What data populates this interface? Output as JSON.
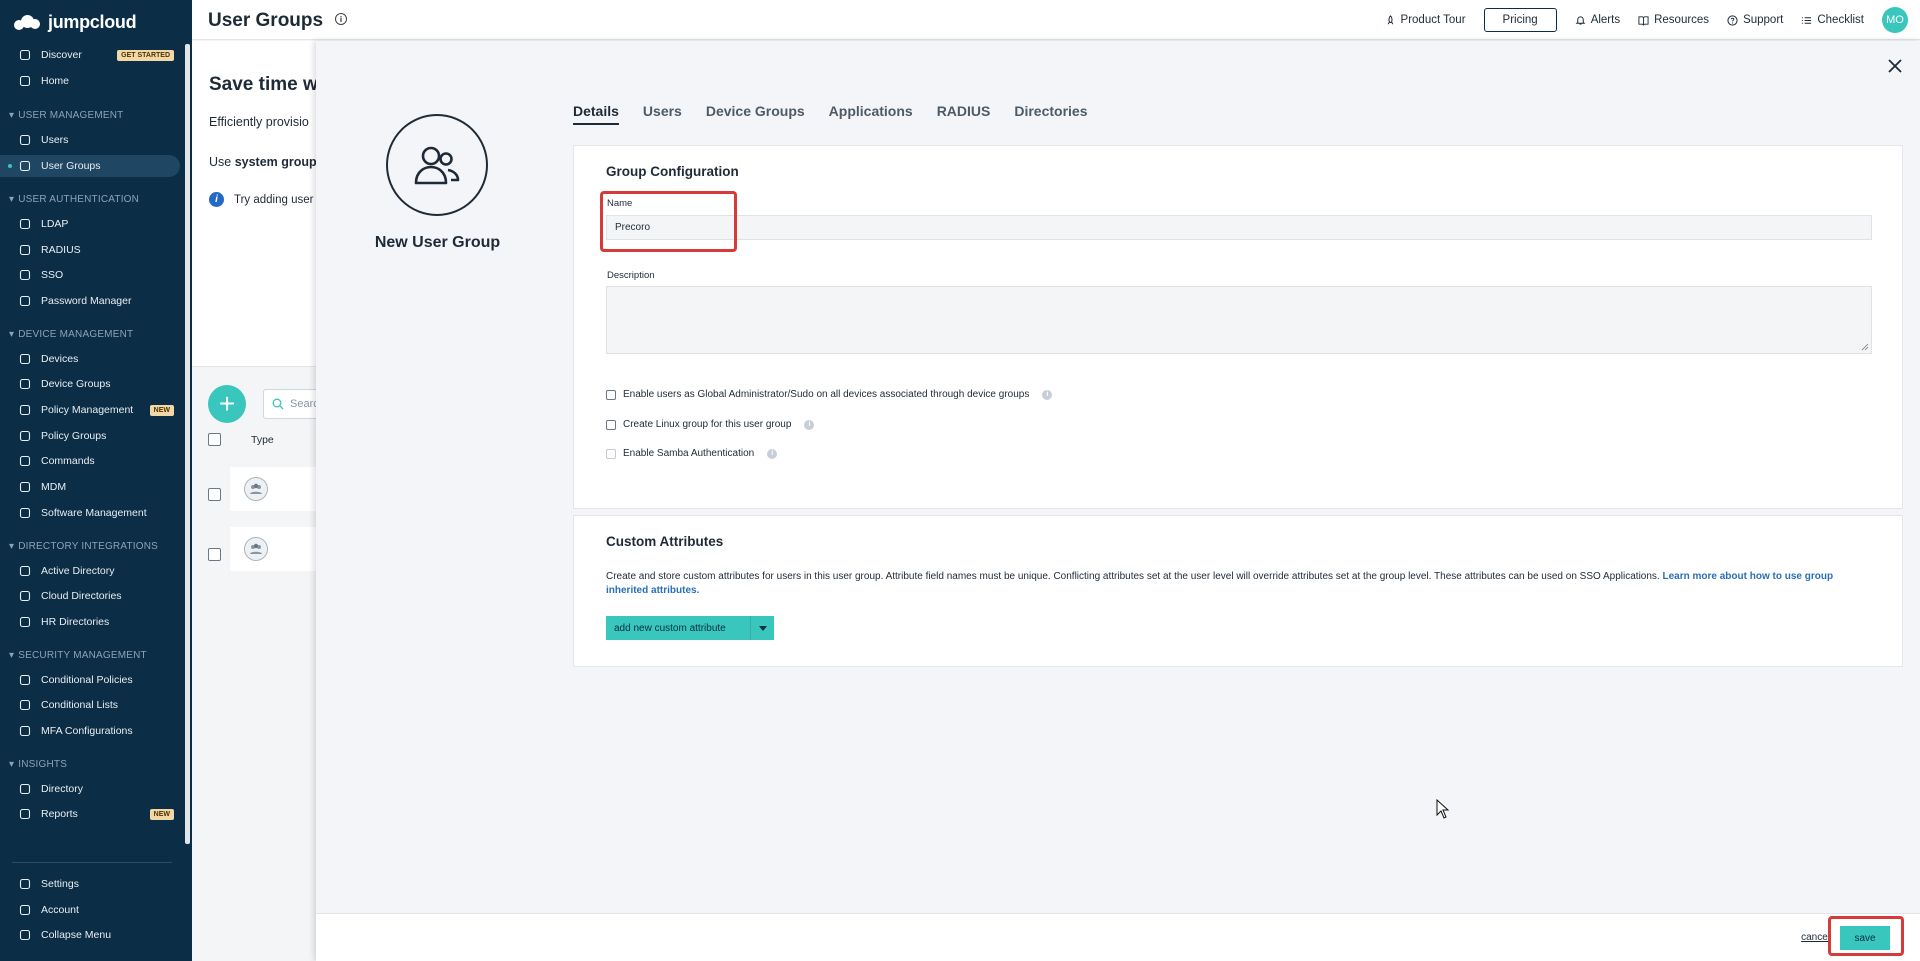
{
  "app": {
    "logo_text": "jumpcloud",
    "page_title": "User Groups"
  },
  "sidebar": {
    "items_top": [
      {
        "label": "Discover",
        "badge": "GET STARTED"
      },
      {
        "label": "Home"
      }
    ],
    "sections": [
      {
        "title": "USER MANAGEMENT",
        "items": [
          {
            "label": "Users"
          },
          {
            "label": "User Groups",
            "active": true
          }
        ]
      },
      {
        "title": "USER AUTHENTICATION",
        "items": [
          {
            "label": "LDAP"
          },
          {
            "label": "RADIUS"
          },
          {
            "label": "SSO"
          },
          {
            "label": "Password Manager"
          }
        ]
      },
      {
        "title": "DEVICE MANAGEMENT",
        "items": [
          {
            "label": "Devices"
          },
          {
            "label": "Device Groups"
          },
          {
            "label": "Policy Management",
            "badge": "NEW"
          },
          {
            "label": "Policy Groups"
          },
          {
            "label": "Commands"
          },
          {
            "label": "MDM"
          },
          {
            "label": "Software Management"
          }
        ]
      },
      {
        "title": "DIRECTORY INTEGRATIONS",
        "items": [
          {
            "label": "Active Directory"
          },
          {
            "label": "Cloud Directories"
          },
          {
            "label": "HR Directories"
          }
        ]
      },
      {
        "title": "SECURITY MANAGEMENT",
        "items": [
          {
            "label": "Conditional Policies"
          },
          {
            "label": "Conditional Lists"
          },
          {
            "label": "MFA Configurations"
          }
        ]
      },
      {
        "title": "INSIGHTS",
        "items": [
          {
            "label": "Directory"
          },
          {
            "label": "Reports",
            "badge": "NEW"
          }
        ]
      }
    ],
    "bottom": [
      {
        "label": "Settings"
      },
      {
        "label": "Account"
      },
      {
        "label": "Collapse Menu"
      }
    ]
  },
  "topnav": {
    "product_tour": "Product Tour",
    "pricing": "Pricing",
    "alerts": "Alerts",
    "resources": "Resources",
    "support": "Support",
    "checklist": "Checklist",
    "avatar_initials": "MO"
  },
  "background": {
    "title": "Save time w",
    "text1": "Efficiently provisio",
    "text2_prefix": "Use ",
    "text2_bold": "system group",
    "info_text": "Try adding user",
    "search_placeholder": "Searc",
    "col_type": "Type"
  },
  "panel": {
    "group_name": "New User Group",
    "tabs": [
      "Details",
      "Users",
      "Device Groups",
      "Applications",
      "RADIUS",
      "Directories"
    ],
    "config": {
      "title": "Group Configuration",
      "name_label": "Name",
      "name_value": "Precoro",
      "description_label": "Description",
      "checks": [
        {
          "label": "Enable users as Global Administrator/Sudo on all devices associated through device groups",
          "help": true
        },
        {
          "label": "Create Linux group for this user group",
          "help": true
        },
        {
          "label": "Enable Samba Authentication",
          "help": true,
          "disabled": true
        }
      ]
    },
    "custom": {
      "title": "Custom Attributes",
      "desc": "Create and store custom attributes for users in this user group. Attribute field names must be unique. Conflicting attributes set at the user level will override attributes set at the group level. These attributes can be used on SSO Applications.",
      "link": "Learn more about how to use group inherited attributes.",
      "add_button": "add new custom attribute"
    },
    "footer": {
      "cancel": "cancel",
      "save": "save"
    }
  },
  "colors": {
    "accent": "#38c6bd",
    "sidebar_bg": "#0b2d45",
    "highlight": "#d63a3a"
  }
}
